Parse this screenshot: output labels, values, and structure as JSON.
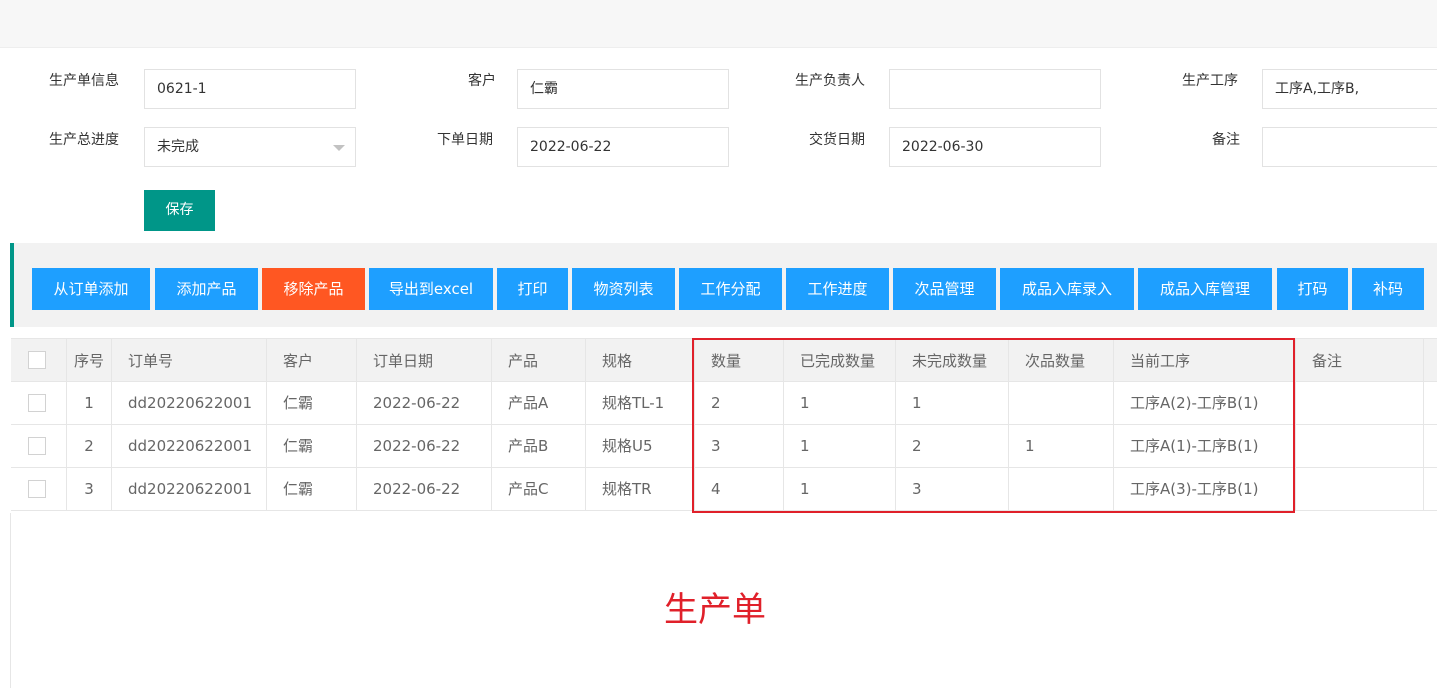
{
  "form": {
    "order_info_label": "生产单信息",
    "order_info_value": "0621-1",
    "customer_label": "客户",
    "customer_value": "仁霸",
    "manager_label": "生产负责人",
    "manager_value": "",
    "process_label": "生产工序",
    "process_value": "工序A,工序B,",
    "progress_label": "生产总进度",
    "progress_value": "未完成",
    "order_date_label": "下单日期",
    "order_date_value": "2022-06-22",
    "delivery_date_label": "交货日期",
    "delivery_date_value": "2022-06-30",
    "remark_label": "备注",
    "remark_value": "",
    "save_label": "保存"
  },
  "toolbar": {
    "buttons": [
      "从订单添加",
      "添加产品",
      "移除产品",
      "导出到excel",
      "打印",
      "物资列表",
      "工作分配",
      "工作进度",
      "次品管理",
      "成品入库录入",
      "成品入库管理",
      "打码",
      "补码"
    ]
  },
  "table": {
    "headers": [
      "序号",
      "订单号",
      "客户",
      "订单日期",
      "产品",
      "规格",
      "数量",
      "已完成数量",
      "未完成数量",
      "次品数量",
      "当前工序",
      "备注"
    ],
    "rows": [
      [
        "1",
        "dd20220622001",
        "仁霸",
        "2022-06-22",
        "产品A",
        "规格TL-1",
        "2",
        "1",
        "1",
        "",
        "工序A(2)-工序B(1)",
        ""
      ],
      [
        "2",
        "dd20220622001",
        "仁霸",
        "2022-06-22",
        "产品B",
        "规格U5",
        "3",
        "1",
        "2",
        "1",
        "工序A(1)-工序B(1)",
        ""
      ],
      [
        "3",
        "dd20220622001",
        "仁霸",
        "2022-06-22",
        "产品C",
        "规格TR",
        "4",
        "1",
        "3",
        "",
        "工序A(3)-工序B(1)",
        ""
      ]
    ]
  },
  "annotation": {
    "caption": "生产单",
    "color": "#e0202a"
  },
  "colors": {
    "primary": "#1e9fff",
    "danger": "#ff5722",
    "save": "#009688"
  }
}
